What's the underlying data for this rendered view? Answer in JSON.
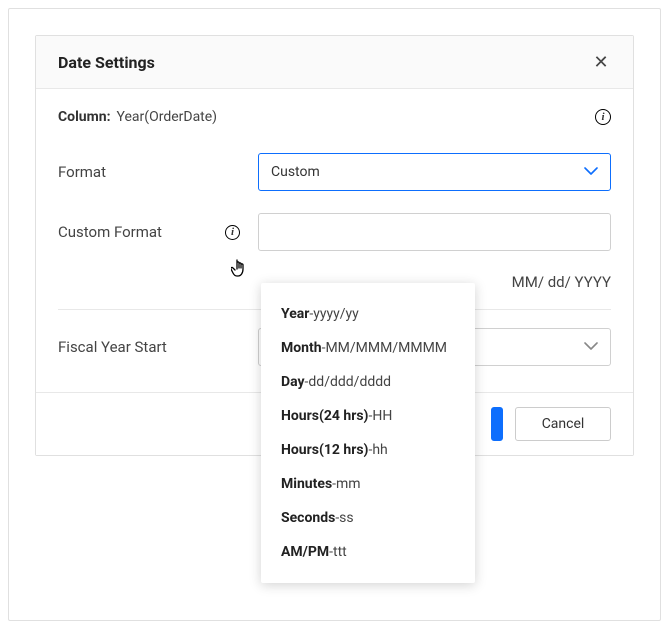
{
  "dialog": {
    "title": "Date Settings",
    "close_aria": "Close"
  },
  "column": {
    "label": "Column:",
    "value": "Year(OrderDate)"
  },
  "format": {
    "label": "Format",
    "selected": "Custom"
  },
  "customFormat": {
    "label": "Custom Format",
    "value": "",
    "placeholder": "",
    "helper": "MM/ dd/ YYYY"
  },
  "fiscalYear": {
    "label": "Fiscal Year Start",
    "selected": ""
  },
  "buttons": {
    "cancel": "Cancel"
  },
  "tooltip": {
    "items": [
      {
        "bold": "Year",
        "rest": "-yyyy/yy"
      },
      {
        "bold": "Month",
        "rest": "-MM/MMM/MMMM"
      },
      {
        "bold": "Day",
        "rest": "-dd/ddd/dddd"
      },
      {
        "bold": "Hours(24 hrs)",
        "rest": "-HH"
      },
      {
        "bold": "Hours(12 hrs)",
        "rest": "-hh"
      },
      {
        "bold": "Minutes",
        "rest": "-mm"
      },
      {
        "bold": "Seconds",
        "rest": "-ss"
      },
      {
        "bold": "AM/PM",
        "rest": "-ttt"
      }
    ]
  }
}
